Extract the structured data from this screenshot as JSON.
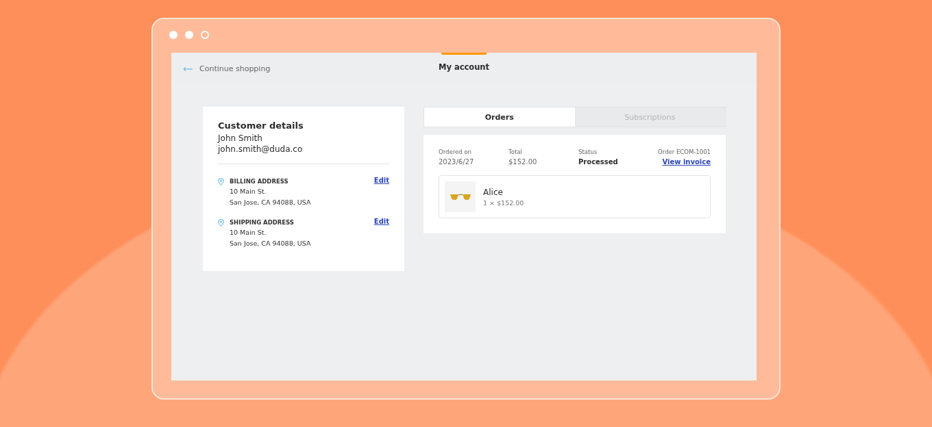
{
  "window": {
    "controls": [
      {
        "kind": "filled"
      },
      {
        "kind": "filled"
      },
      {
        "kind": "outline"
      }
    ]
  },
  "header": {
    "back_link": "Continue shopping",
    "title": "My account"
  },
  "customer": {
    "heading": "Customer details",
    "name": "John Smith",
    "email": "john.smith@duda.co",
    "addresses": [
      {
        "label": "BILLING ADDRESS",
        "lines": [
          "10 Main St.",
          "San Jose, CA 94088, USA"
        ],
        "edit": "Edit"
      },
      {
        "label": "SHIPPING ADDRESS",
        "lines": [
          "10 Main St.",
          "San Jose, CA 94088, USA"
        ],
        "edit": "Edit"
      }
    ]
  },
  "tabs": [
    {
      "label": "Orders",
      "selected": true
    },
    {
      "label": "Subscriptions",
      "selected": false
    }
  ],
  "order": {
    "fields": [
      {
        "kind": "plain",
        "label": "Ordered on",
        "value": "2023/6/27"
      },
      {
        "kind": "plain",
        "label": "Total",
        "value": "$152.00"
      },
      {
        "kind": "status",
        "label": "Status",
        "value": "Processed"
      }
    ],
    "number": "Order ECOM-1001",
    "invoice_link": "View invoice",
    "items": [
      {
        "name": "Alice",
        "quantity_price": "1 × $152.00"
      }
    ]
  }
}
